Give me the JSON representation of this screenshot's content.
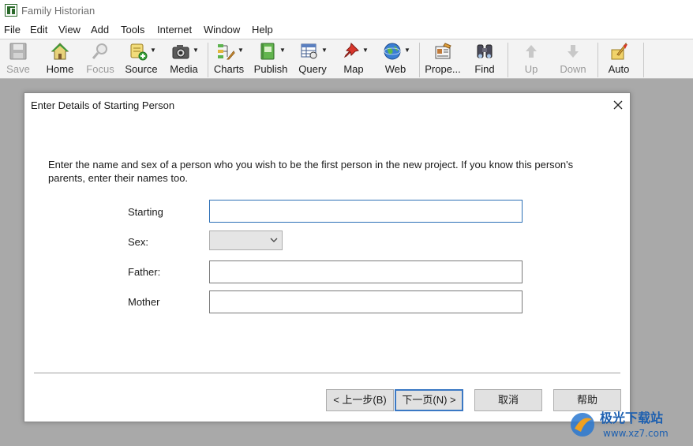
{
  "window": {
    "title": "Family Historian",
    "icon": "family-tree-app-icon"
  },
  "menubar": {
    "items": [
      "File",
      "Edit",
      "View",
      "Add",
      "Tools",
      "Internet",
      "Window",
      "Help"
    ]
  },
  "toolbar": {
    "save": {
      "label": "Save",
      "icon": "floppy-disk-icon",
      "enabled": false
    },
    "home": {
      "label": "Home",
      "icon": "house-icon",
      "enabled": true
    },
    "focus": {
      "label": "Focus",
      "icon": "magnifier-icon",
      "enabled": false
    },
    "source": {
      "label": "Source",
      "icon": "scroll-add-icon",
      "enabled": true
    },
    "media": {
      "label": "Media",
      "icon": "camera-icon",
      "enabled": true
    },
    "charts": {
      "label": "Charts",
      "icon": "tree-chart-icon",
      "enabled": true
    },
    "publish": {
      "label": "Publish",
      "icon": "green-book-icon",
      "enabled": true
    },
    "query": {
      "label": "Query",
      "icon": "table-query-icon",
      "enabled": true
    },
    "map": {
      "label": "Map",
      "icon": "red-pushpin-icon",
      "enabled": true
    },
    "web": {
      "label": "Web",
      "icon": "globe-icon",
      "enabled": true
    },
    "properties": {
      "label": "Prope...",
      "icon": "properties-card-icon",
      "enabled": true
    },
    "find": {
      "label": "Find",
      "icon": "binoculars-icon",
      "enabled": true
    },
    "up": {
      "label": "Up",
      "icon": "up-arrow-icon",
      "enabled": false
    },
    "down": {
      "label": "Down",
      "icon": "down-arrow-icon",
      "enabled": false
    },
    "auto": {
      "label": "Auto",
      "icon": "quill-pen-icon",
      "enabled": true
    }
  },
  "dialog": {
    "title": "Enter Details of Starting Person",
    "intro": "Enter the name and sex of a person who you wish to be the first person in the new project.  If you know this person's parents, enter their names too.",
    "fields": {
      "starting_label": "Starting",
      "starting_value": "",
      "sex_label": "Sex:",
      "sex_value": "",
      "father_label": "Father:",
      "father_value": "",
      "mother_label": "Mother",
      "mother_value": ""
    },
    "buttons": {
      "back": "< 上一步(B)",
      "next": "下一页(N) >",
      "cancel": "取消",
      "help": "帮助"
    }
  },
  "watermark": {
    "brand": "极光下载站",
    "url": "www.xz7.com"
  },
  "colors": {
    "focus_border": "#2c6fb6",
    "default_button_border": "#3a78c4"
  }
}
